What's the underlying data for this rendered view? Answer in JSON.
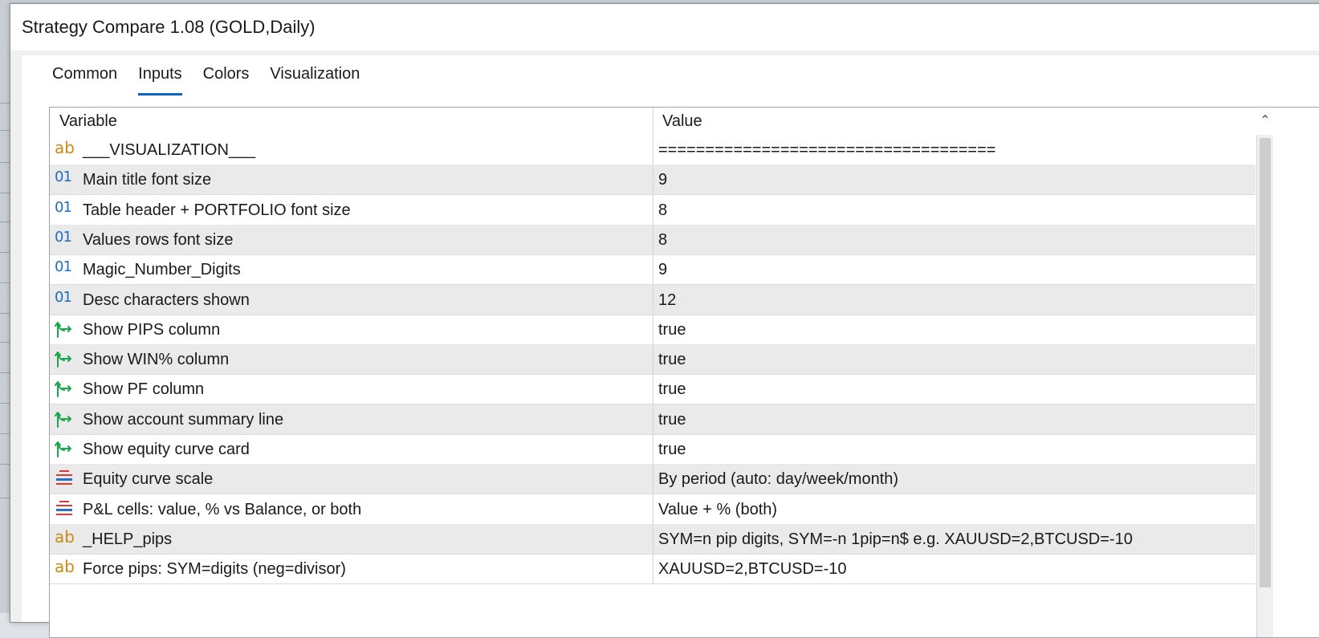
{
  "window": {
    "title": "Strategy Compare 1.08 (GOLD,Daily)"
  },
  "tabs": [
    {
      "label": "Common",
      "active": false
    },
    {
      "label": "Inputs",
      "active": true
    },
    {
      "label": "Colors",
      "active": false
    },
    {
      "label": "Visualization",
      "active": false
    }
  ],
  "grid": {
    "columns": {
      "variable": "Variable",
      "value": "Value"
    },
    "rows": [
      {
        "type": "string",
        "icon": "string-icon",
        "variable": "___VISUALIZATION___",
        "value": "===================================="
      },
      {
        "type": "int",
        "icon": "integer-icon",
        "variable": "Main title font size",
        "value": "9"
      },
      {
        "type": "int",
        "icon": "integer-icon",
        "variable": "Table header + PORTFOLIO font size",
        "value": "8"
      },
      {
        "type": "int",
        "icon": "integer-icon",
        "variable": "Values rows font size",
        "value": "8"
      },
      {
        "type": "int",
        "icon": "integer-icon",
        "variable": "Magic_Number_Digits",
        "value": "9"
      },
      {
        "type": "int",
        "icon": "integer-icon",
        "variable": "Desc characters shown",
        "value": "12"
      },
      {
        "type": "bool",
        "icon": "boolean-icon",
        "variable": "Show PIPS column",
        "value": "true"
      },
      {
        "type": "bool",
        "icon": "boolean-icon",
        "variable": "Show WIN% column",
        "value": "true"
      },
      {
        "type": "bool",
        "icon": "boolean-icon",
        "variable": "Show PF column",
        "value": "true"
      },
      {
        "type": "bool",
        "icon": "boolean-icon",
        "variable": "Show account summary line",
        "value": "true"
      },
      {
        "type": "bool",
        "icon": "boolean-icon",
        "variable": "Show equity curve card",
        "value": "true"
      },
      {
        "type": "enum",
        "icon": "enum-icon",
        "variable": "Equity curve scale",
        "value": "By period (auto: day/week/month)"
      },
      {
        "type": "enum",
        "icon": "enum-icon",
        "variable": "P&L cells: value, % vs Balance, or both",
        "value": "Value + % (both)"
      },
      {
        "type": "string",
        "icon": "string-icon",
        "variable": "_HELP_pips",
        "value": "SYM=n pip digits, SYM=-n 1pip=n$  e.g. XAUUSD=2,BTCUSD=-10"
      },
      {
        "type": "string",
        "icon": "string-icon",
        "variable": "Force pips: SYM=digits (neg=divisor)",
        "value": "XAUUSD=2,BTCUSD=-10"
      }
    ]
  },
  "colors": {
    "accent": "#0a64c8",
    "string_icon": "#c98a12",
    "int_icon": "#1f6fbf",
    "bool_icon": "#1aa64a",
    "enum_icon_red": "#d63a3a",
    "enum_icon_blue": "#2a6fc9",
    "row_alt": "#eaeaea"
  }
}
